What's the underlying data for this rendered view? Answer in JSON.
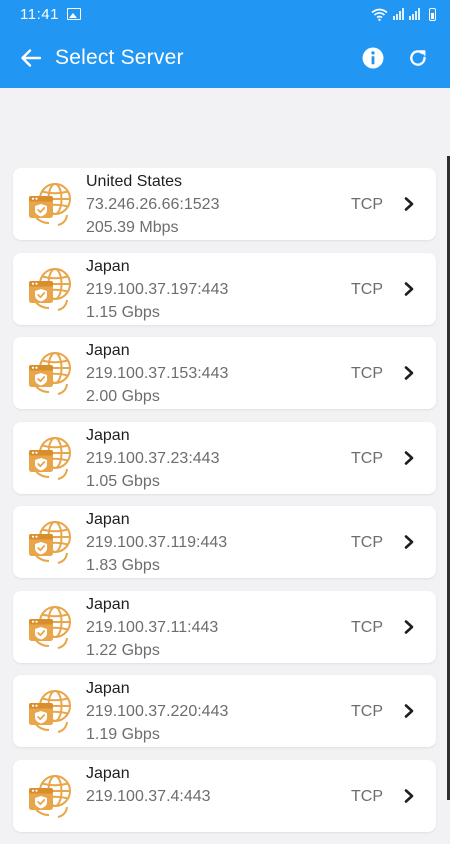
{
  "status_bar": {
    "time": "11:41"
  },
  "header": {
    "title": "Select Server"
  },
  "colors": {
    "primary": "#2196f3",
    "server_icon": "#e8a54a"
  },
  "servers": [
    {
      "country": "United States",
      "address": "73.246.26.66:1523",
      "speed": "205.39 Mbps",
      "protocol": "TCP"
    },
    {
      "country": "Japan",
      "address": "219.100.37.197:443",
      "speed": "1.15 Gbps",
      "protocol": "TCP"
    },
    {
      "country": "Japan",
      "address": "219.100.37.153:443",
      "speed": "2.00 Gbps",
      "protocol": "TCP"
    },
    {
      "country": "Japan",
      "address": "219.100.37.23:443",
      "speed": "1.05 Gbps",
      "protocol": "TCP"
    },
    {
      "country": "Japan",
      "address": "219.100.37.119:443",
      "speed": "1.83 Gbps",
      "protocol": "TCP"
    },
    {
      "country": "Japan",
      "address": "219.100.37.11:443",
      "speed": "1.22 Gbps",
      "protocol": "TCP"
    },
    {
      "country": "Japan",
      "address": "219.100.37.220:443",
      "speed": "1.19 Gbps",
      "protocol": "TCP"
    },
    {
      "country": "Japan",
      "address": "219.100.37.4:443",
      "speed": "",
      "protocol": "TCP"
    }
  ]
}
